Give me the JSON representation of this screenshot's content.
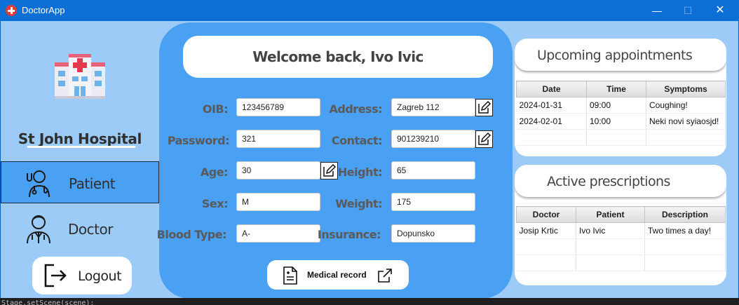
{
  "titlebar": {
    "title": "DoctorApp",
    "min": "—",
    "max": "☐",
    "close": "✕"
  },
  "sidebar": {
    "hospital_name": "St John Hospital",
    "items": [
      {
        "label": "Patient",
        "icon": "patient-icon",
        "active": true
      },
      {
        "label": "Doctor",
        "icon": "doctor-icon",
        "active": false
      }
    ],
    "logout_label": "Logout"
  },
  "main": {
    "welcome": "Welcome back, Ivo Ivic",
    "fields": {
      "oib": {
        "label": "OIB:",
        "value": "123456789"
      },
      "password": {
        "label": "Password:",
        "value": "321"
      },
      "age": {
        "label": "Age:",
        "value": "30"
      },
      "sex": {
        "label": "Sex:",
        "value": "M"
      },
      "blood": {
        "label": "Blood Type:",
        "value": "A-"
      },
      "address": {
        "label": "Address:",
        "value": "Zagreb 112"
      },
      "contact": {
        "label": "Contact:",
        "value": "901239210"
      },
      "height": {
        "label": "Height:",
        "value": "65"
      },
      "weight": {
        "label": "Weight:",
        "value": "175"
      },
      "insurance": {
        "label": "Insurance:",
        "value": "Dopunsko"
      }
    },
    "medical_record_label": "Medical record"
  },
  "appointments": {
    "title": "Upcoming appointments",
    "columns": [
      "Date",
      "Time",
      "Symptoms"
    ],
    "rows": [
      [
        "2024-01-31",
        "09:00",
        "Coughing!"
      ],
      [
        "2024-02-01",
        "10:00",
        "Neki novi syiaosjd!"
      ]
    ]
  },
  "prescriptions": {
    "title": "Active prescriptions",
    "columns": [
      "Doctor",
      "Patient",
      "Description"
    ],
    "rows": [
      [
        "Josip Krtic",
        "Ivo Ivic",
        "Two times a day!"
      ]
    ]
  },
  "console_text": "Stage.setScene(scene);",
  "colors": {
    "titlebar": "#0b6fd6",
    "window_bg": "#9ccbf7",
    "main_panel": "#4aa0f2",
    "active_nav": "#4aa0f2"
  }
}
